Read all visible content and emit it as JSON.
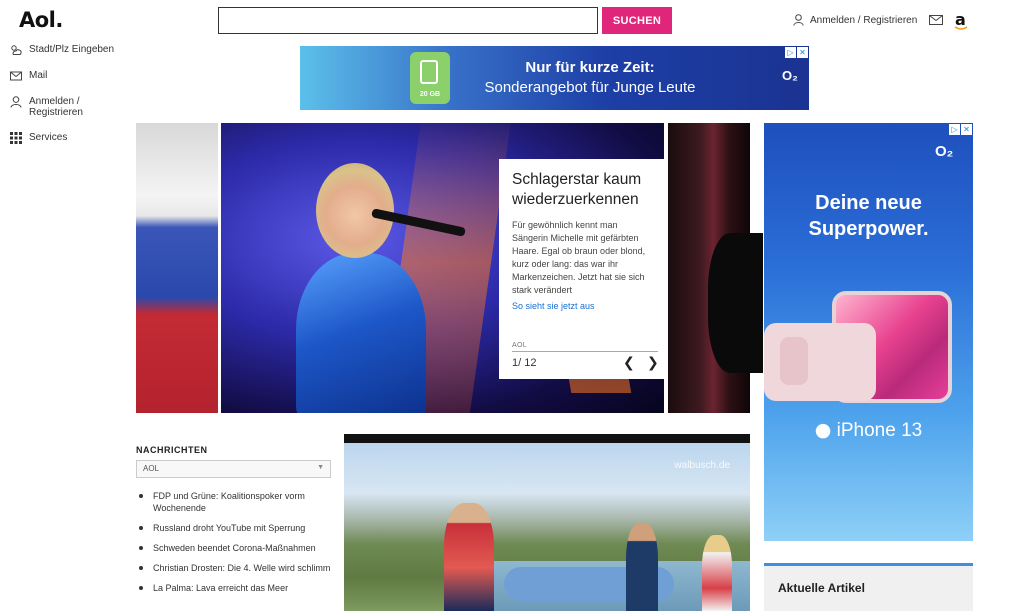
{
  "header": {
    "logo": "Aol.",
    "search_placeholder": "",
    "search_button": "SUCHEN",
    "login_label": "Anmelden / Registrieren",
    "amazon_logo": "a"
  },
  "sidebar": {
    "items": [
      {
        "label": "Stadt/Plz Eingeben",
        "icon": "weather-icon"
      },
      {
        "label": "Mail",
        "icon": "mail-icon"
      },
      {
        "label": "Anmelden / Registrieren",
        "icon": "user-icon"
      },
      {
        "label": "Services",
        "icon": "grid-icon"
      }
    ]
  },
  "ad_top": {
    "sim_label": "20 GB",
    "line1": "Nur für kurze Zeit:",
    "line2": "Sonderangebot für Junge Leute",
    "brand": "O₂",
    "badge": [
      "▷",
      "✕"
    ]
  },
  "slideshow": {
    "title": "Schlagerstar kaum wiederzuerkennen",
    "text": "Für gewöhnlich kennt man Sängerin Michelle mit gefärbten Haare. Egal ob braun oder blond, kurz oder lang: das war ihr Markenzeichen. Jetzt hat sie sich stark verändert",
    "link": "So sieht sie jetzt aus",
    "source": "AOL",
    "counter": "1/ 12",
    "prev": "❮",
    "next": "❯"
  },
  "ad_right": {
    "brand": "O₂",
    "headline": "Deine neue Superpower.",
    "product": "iPhone 13",
    "badge": [
      "▷",
      "✕"
    ]
  },
  "news": {
    "heading": "NACHRICHTEN",
    "select_value": "AOL",
    "items": [
      "FDP und Grüne: Koalitionspoker vorm Wochenende",
      "Russland droht YouTube mit Sperrung",
      "Schweden beendet Corona-Maßnahmen",
      "Christian Drosten: Die 4. Welle wird schlimm",
      "La Palma: Lava erreicht das Meer"
    ]
  },
  "video": {
    "watermark": "walbusch.de"
  },
  "articles": {
    "title": "Aktuelle Artikel"
  },
  "colors": {
    "accent": "#e0267a",
    "link": "#1a6fd0",
    "ad_blue": "#1d3fa6"
  }
}
